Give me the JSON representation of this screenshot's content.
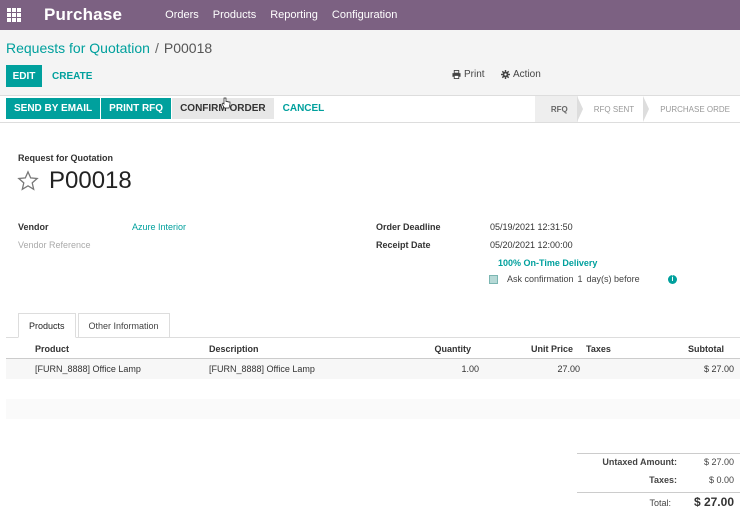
{
  "navbar": {
    "app_name": "Purchase",
    "menu": [
      "Orders",
      "Products",
      "Reporting",
      "Configuration"
    ]
  },
  "breadcrumb": {
    "parent": "Requests for Quotation",
    "separator": "/",
    "current": "P00018"
  },
  "control": {
    "edit_label": "EDIT",
    "create_label": "CREATE",
    "print_label": "Print",
    "action_label": "Action"
  },
  "statusbar": {
    "buttons": [
      "SEND BY EMAIL",
      "PRINT RFQ",
      "CONFIRM ORDER",
      "CANCEL"
    ],
    "stages": [
      "RFQ",
      "RFQ SENT",
      "PURCHASE ORDE"
    ]
  },
  "form": {
    "title": "Request for Quotation",
    "name": "P00018",
    "vendor_label": "Vendor",
    "vendor_value": "Azure Interior",
    "vendor_ref_label": "Vendor Reference",
    "order_deadline_label": "Order Deadline",
    "order_deadline_value": "05/19/2021 12:31:50",
    "receipt_date_label": "Receipt Date",
    "receipt_date_value": "05/20/2021 12:00:00",
    "on_time": "100% On-Time Delivery",
    "ask_confirmation": "Ask confirmation",
    "ask_days": "1",
    "ask_suffix": "day(s) before"
  },
  "tabs": [
    "Products",
    "Other Information"
  ],
  "lines": {
    "headers": {
      "product": "Product",
      "description": "Description",
      "quantity": "Quantity",
      "unit_price": "Unit Price",
      "taxes": "Taxes",
      "subtotal": "Subtotal"
    },
    "rows": [
      {
        "product": "[FURN_8888] Office Lamp",
        "description": "[FURN_8888] Office Lamp",
        "quantity": "1.00",
        "unit_price": "27.00",
        "taxes": "",
        "subtotal": "$ 27.00"
      }
    ]
  },
  "totals": {
    "untaxed_label": "Untaxed Amount:",
    "untaxed_value": "$ 27.00",
    "taxes_label": "Taxes:",
    "taxes_value": "$ 0.00",
    "total_label": "Total:",
    "total_value": "$ 27.00"
  },
  "colors": {
    "navbar": "#7c6182",
    "primary": "#00a09d"
  },
  "icons": {
    "apps": "apps-grid-icon",
    "print": "printer-icon",
    "action": "gear-icon",
    "favorite": "star-icon",
    "info": "info-icon"
  }
}
